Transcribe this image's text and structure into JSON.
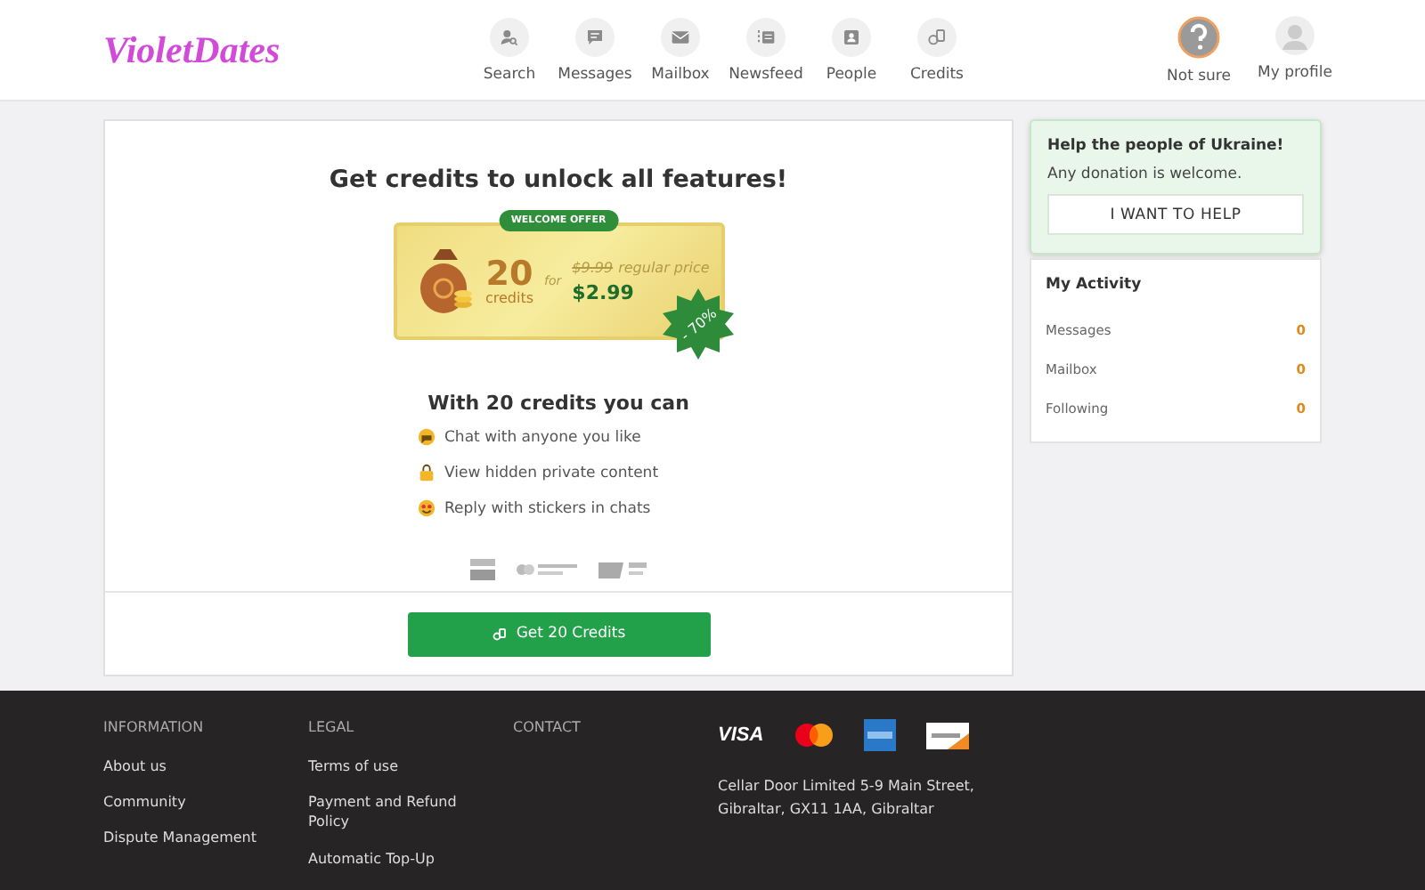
{
  "header": {
    "logo": "VioletDates",
    "nav": [
      {
        "label": "Search",
        "kind": "search"
      },
      {
        "label": "Messages",
        "kind": "messages"
      },
      {
        "label": "Mailbox",
        "kind": "mailbox"
      },
      {
        "label": "Newsfeed",
        "kind": "newsfeed"
      },
      {
        "label": "People",
        "kind": "people"
      },
      {
        "label": "Credits",
        "kind": "credits"
      }
    ],
    "user": [
      {
        "label": "Not sure",
        "kind": "question"
      },
      {
        "label": "My profile",
        "kind": "avatar"
      }
    ]
  },
  "offer": {
    "title": "Get credits to unlock all features!",
    "badge": "WELCOME OFFER",
    "amount": "20",
    "unit": "credits",
    "for": "for",
    "old_price": "$9.99",
    "regular": "regular price",
    "price": "$2.99",
    "discount": "- 70%",
    "subtitle": "With 20 credits you can",
    "features": [
      {
        "kind": "chat",
        "text": "Chat with anyone you like"
      },
      {
        "kind": "lock",
        "text": "View hidden private content"
      },
      {
        "kind": "smile",
        "text": "Reply with stickers in chats"
      }
    ],
    "button": "Get 20 Credits"
  },
  "ukraine": {
    "title": "Help the people of Ukraine!",
    "text": "Any donation is welcome.",
    "button": "I WANT TO HELP"
  },
  "activity": {
    "title": "My Activity",
    "rows": [
      {
        "label": "Messages",
        "count": "0"
      },
      {
        "label": "Mailbox",
        "count": "0"
      },
      {
        "label": "Following",
        "count": "0"
      }
    ]
  },
  "footer": {
    "columns": [
      {
        "title": "INFORMATION",
        "links": [
          "About us",
          "Community",
          "Dispute Management"
        ]
      },
      {
        "title": "LEGAL",
        "links": [
          "Terms of use",
          "Payment and Refund Policy",
          "Automatic Top-Up"
        ]
      },
      {
        "title": "CONTACT"
      }
    ],
    "visa": "VISA",
    "address": "Cellar Door Limited 5-9 Main Street, Gibraltar, GX11 1AA, Gibraltar"
  }
}
